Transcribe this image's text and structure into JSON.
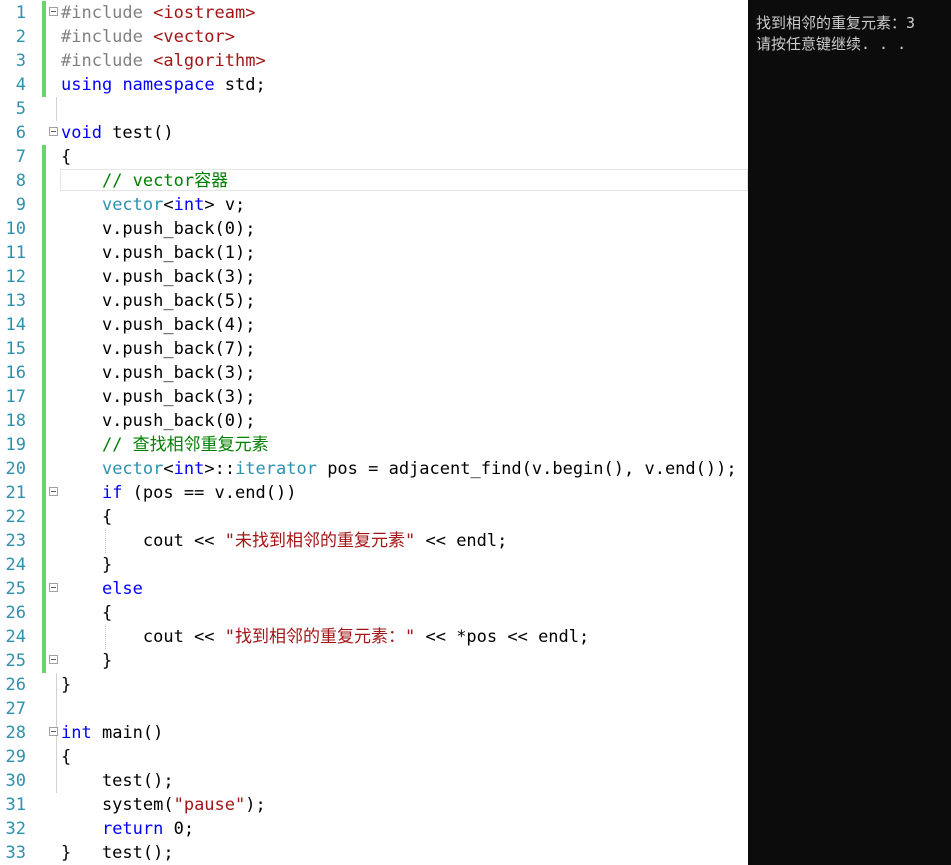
{
  "editor": {
    "lines": [
      {
        "num": "1",
        "tokens": [
          {
            "c": "p",
            "t": "#include "
          },
          {
            "c": "s",
            "t": "<iostream>"
          }
        ]
      },
      {
        "num": "2",
        "tokens": [
          {
            "c": "p",
            "t": "#include "
          },
          {
            "c": "s",
            "t": "<vector>"
          }
        ]
      },
      {
        "num": "3",
        "tokens": [
          {
            "c": "p",
            "t": "#include "
          },
          {
            "c": "s",
            "t": "<algorithm>"
          }
        ]
      },
      {
        "num": "4",
        "tokens": [
          {
            "c": "k",
            "t": "using"
          },
          {
            "c": "n",
            "t": " "
          },
          {
            "c": "k",
            "t": "namespace"
          },
          {
            "c": "n",
            "t": " std;"
          }
        ]
      },
      {
        "num": "5",
        "tokens": []
      },
      {
        "num": "6",
        "tokens": [
          {
            "c": "k",
            "t": "void"
          },
          {
            "c": "n",
            "t": " test()"
          }
        ]
      },
      {
        "num": "7",
        "tokens": [
          {
            "c": "n",
            "t": "{"
          }
        ]
      },
      {
        "num": "8",
        "tokens": [
          {
            "c": "n",
            "t": "    "
          },
          {
            "c": "c",
            "t": "// vector容器"
          }
        ]
      },
      {
        "num": "9",
        "tokens": [
          {
            "c": "n",
            "t": "    "
          },
          {
            "c": "t",
            "t": "vector"
          },
          {
            "c": "n",
            "t": "<"
          },
          {
            "c": "k",
            "t": "int"
          },
          {
            "c": "n",
            "t": "> v;"
          }
        ]
      },
      {
        "num": "10",
        "tokens": [
          {
            "c": "n",
            "t": "    v.push_back(0);"
          }
        ]
      },
      {
        "num": "11",
        "tokens": [
          {
            "c": "n",
            "t": "    v.push_back(1);"
          }
        ]
      },
      {
        "num": "12",
        "tokens": [
          {
            "c": "n",
            "t": "    v.push_back(3);"
          }
        ]
      },
      {
        "num": "13",
        "tokens": [
          {
            "c": "n",
            "t": "    v.push_back(5);"
          }
        ]
      },
      {
        "num": "14",
        "tokens": [
          {
            "c": "n",
            "t": "    v.push_back(4);"
          }
        ]
      },
      {
        "num": "15",
        "tokens": [
          {
            "c": "n",
            "t": "    v.push_back(7);"
          }
        ]
      },
      {
        "num": "16",
        "tokens": [
          {
            "c": "n",
            "t": "    v.push_back(3);"
          }
        ]
      },
      {
        "num": "17",
        "tokens": [
          {
            "c": "n",
            "t": "    v.push_back(3);"
          }
        ]
      },
      {
        "num": "18",
        "tokens": [
          {
            "c": "n",
            "t": "    v.push_back(0);"
          }
        ]
      },
      {
        "num": "19",
        "tokens": [
          {
            "c": "n",
            "t": "    "
          },
          {
            "c": "c",
            "t": "// 查找相邻重复元素"
          }
        ]
      },
      {
        "num": "20",
        "tokens": [
          {
            "c": "n",
            "t": "    "
          },
          {
            "c": "t",
            "t": "vector"
          },
          {
            "c": "n",
            "t": "<"
          },
          {
            "c": "k",
            "t": "int"
          },
          {
            "c": "n",
            "t": ">::"
          },
          {
            "c": "t",
            "t": "iterator"
          },
          {
            "c": "n",
            "t": " pos = adjacent_find(v.begin(), v.end());"
          }
        ]
      },
      {
        "num": "21",
        "tokens": [
          {
            "c": "n",
            "t": "    "
          },
          {
            "c": "k",
            "t": "if"
          },
          {
            "c": "n",
            "t": " (pos == v.end())"
          }
        ]
      },
      {
        "num": "22",
        "tokens": [
          {
            "c": "n",
            "t": "    {"
          }
        ]
      },
      {
        "num": "23",
        "tokens": [
          {
            "c": "n",
            "t": "        cout << "
          },
          {
            "c": "s",
            "t": "\"未找到相邻的重复元素\""
          },
          {
            "c": "n",
            "t": " << endl;"
          }
        ]
      },
      {
        "num": "24",
        "tokens": [
          {
            "c": "n",
            "t": "    }"
          }
        ]
      },
      {
        "num": "25",
        "tokens": [
          {
            "c": "n",
            "t": "    "
          },
          {
            "c": "k",
            "t": "else"
          }
        ]
      },
      {
        "num": "26",
        "tokens": [
          {
            "c": "n",
            "t": "    {"
          }
        ]
      },
      {
        "num": "24",
        "tokens": [
          {
            "c": "n",
            "t": "        cout << "
          },
          {
            "c": "s",
            "t": "\"找到相邻的重复元素：\""
          },
          {
            "c": "n",
            "t": " << *pos << endl;"
          }
        ]
      },
      {
        "num": "25",
        "tokens": [
          {
            "c": "n",
            "t": "    }"
          }
        ]
      },
      {
        "num": "26",
        "tokens": [
          {
            "c": "n",
            "t": "}"
          }
        ]
      },
      {
        "num": "27",
        "tokens": []
      },
      {
        "num": "28",
        "tokens": [
          {
            "c": "k",
            "t": "int"
          },
          {
            "c": "n",
            "t": " main()"
          }
        ]
      },
      {
        "num": "29",
        "tokens": [
          {
            "c": "n",
            "t": "{"
          }
        ]
      },
      {
        "num": "30",
        "tokens": [
          {
            "c": "n",
            "t": "    test();"
          }
        ]
      },
      {
        "num": "31",
        "tokens": [
          {
            "c": "n",
            "t": "    system("
          },
          {
            "c": "s",
            "t": "\"pause\""
          },
          {
            "c": "n",
            "t": ");"
          }
        ]
      },
      {
        "num": "32",
        "tokens": [
          {
            "c": "n",
            "t": "    "
          },
          {
            "c": "k",
            "t": "return"
          },
          {
            "c": "n",
            "t": " 0;"
          }
        ]
      },
      {
        "num": "33",
        "tokens": [
          {
            "c": "n",
            "t": "}   test();"
          }
        ]
      }
    ]
  },
  "console": {
    "lines": [
      "找到相邻的重复元素：3",
      "请按任意键继续. . ."
    ]
  },
  "colors": {
    "keyword": "#0000ff",
    "type": "#2b91af",
    "string": "#a31515",
    "comment": "#008000",
    "preprocessor": "#808080",
    "line_number": "#2b91af",
    "change_bar": "#6bd46b",
    "console_bg": "#0c0c0c",
    "console_text": "#cccccc"
  }
}
